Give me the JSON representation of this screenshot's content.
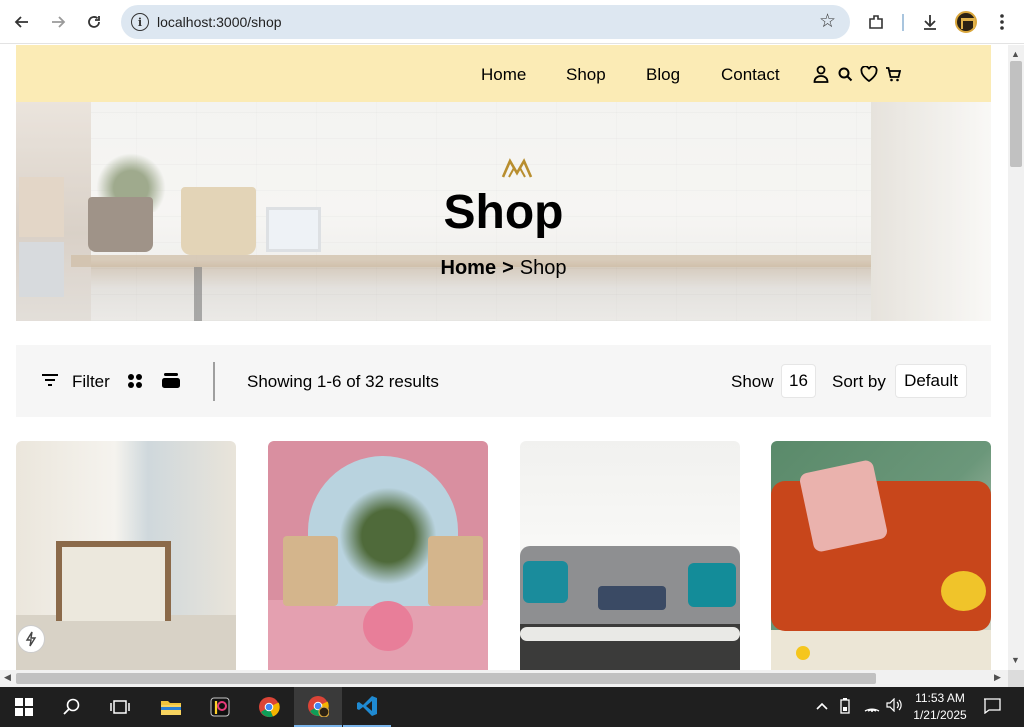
{
  "browser": {
    "url": "localhost:3000/shop"
  },
  "nav": {
    "items": [
      "Home",
      "Shop",
      "Blog",
      "Contact"
    ]
  },
  "hero": {
    "title": "Shop",
    "breadcrumb_home": "Home",
    "breadcrumb_sep": ">",
    "breadcrumb_current": "Shop"
  },
  "filterbar": {
    "filter_label": "Filter",
    "results_text": "Showing 1-6 of 32 results",
    "show_label": "Show",
    "show_value": "16",
    "sort_label": "Sort by",
    "sort_value": "Default"
  },
  "products": [
    {
      "image": "woven lounge chair by window"
    },
    {
      "image": "pink terrace with rattan chairs"
    },
    {
      "image": "grey tufted sofa with teal pillows"
    },
    {
      "image": "orange sofa with pink pillow"
    }
  ],
  "taskbar": {
    "time": "11:53 AM",
    "date": "1/21/2025"
  },
  "colors": {
    "header_bg": "#fbebb5",
    "filterbar_bg": "#f6f6f6",
    "accent_gold": "#b88e2f",
    "taskbar_bg": "#1f1f1f"
  }
}
